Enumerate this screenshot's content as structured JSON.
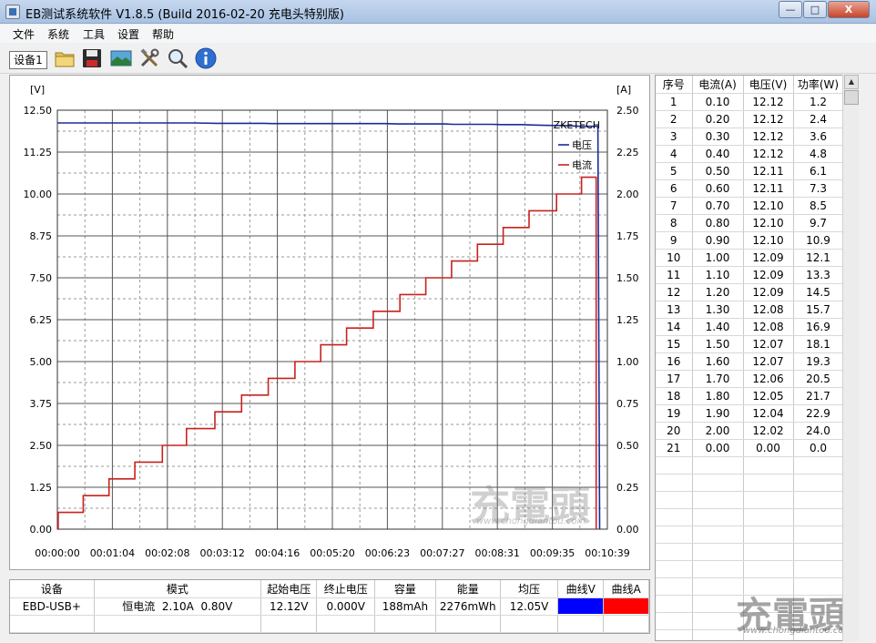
{
  "window": {
    "title": "EB测试系统软件 V1.8.5 (Build 2016-02-20 充电头特别版)",
    "minimize": "—",
    "maximize": "□",
    "close": "X"
  },
  "menu": [
    "文件",
    "系统",
    "工具",
    "设置",
    "帮助"
  ],
  "toolbar": {
    "device_tab": "设备1",
    "icons": [
      "folder-icon",
      "save-icon",
      "image-icon",
      "tools-icon",
      "zoom-icon",
      "info-icon"
    ]
  },
  "chart_data": {
    "type": "line",
    "title": "",
    "y_left_unit": "[V]",
    "y_right_unit": "[A]",
    "y_left_ticks": [
      "12.50",
      "11.25",
      "10.00",
      "8.75",
      "7.50",
      "6.25",
      "5.00",
      "3.75",
      "2.50",
      "1.25",
      "0.00"
    ],
    "y_right_ticks": [
      "2.50",
      "2.25",
      "2.00",
      "1.75",
      "1.50",
      "1.25",
      "1.00",
      "0.75",
      "0.50",
      "0.25",
      "0.00"
    ],
    "x_ticks": [
      "00:00:00",
      "00:01:04",
      "00:02:08",
      "00:03:12",
      "00:04:16",
      "00:05:20",
      "00:06:23",
      "00:07:27",
      "00:08:31",
      "00:09:35",
      "00:10:39"
    ],
    "ylim_left": [
      0,
      12.5
    ],
    "ylim_right": [
      0,
      2.5
    ],
    "xlim_seconds": [
      0,
      639
    ],
    "brand_label": "ZKETECH",
    "legend_position": "top-right",
    "series": [
      {
        "name": "电压",
        "axis": "left",
        "color": "#1c2a9a",
        "points": [
          [
            0,
            12.12
          ],
          [
            160,
            12.12
          ],
          [
            185,
            12.11
          ],
          [
            240,
            12.11
          ],
          [
            250,
            12.1
          ],
          [
            380,
            12.1
          ],
          [
            395,
            12.09
          ],
          [
            450,
            12.09
          ],
          [
            460,
            12.08
          ],
          [
            505,
            12.08
          ],
          [
            515,
            12.07
          ],
          [
            540,
            12.07
          ],
          [
            550,
            12.06
          ],
          [
            565,
            12.05
          ],
          [
            590,
            12.04
          ],
          [
            610,
            12.02
          ],
          [
            628,
            12.02
          ],
          [
            630,
            0.0
          ]
        ]
      },
      {
        "name": "电流",
        "axis": "right",
        "color": "#c8221e",
        "points": [
          [
            0,
            0.0
          ],
          [
            1,
            0.0
          ],
          [
            1,
            0.1
          ],
          [
            30,
            0.1
          ],
          [
            30,
            0.2
          ],
          [
            60,
            0.2
          ],
          [
            60,
            0.3
          ],
          [
            90,
            0.3
          ],
          [
            90,
            0.4
          ],
          [
            122,
            0.4
          ],
          [
            122,
            0.5
          ],
          [
            150,
            0.5
          ],
          [
            150,
            0.6
          ],
          [
            183,
            0.6
          ],
          [
            183,
            0.7
          ],
          [
            214,
            0.7
          ],
          [
            214,
            0.8
          ],
          [
            245,
            0.8
          ],
          [
            245,
            0.9
          ],
          [
            276,
            0.9
          ],
          [
            276,
            1.0
          ],
          [
            306,
            1.0
          ],
          [
            306,
            1.1
          ],
          [
            336,
            1.1
          ],
          [
            336,
            1.2
          ],
          [
            367,
            1.2
          ],
          [
            367,
            1.3
          ],
          [
            398,
            1.3
          ],
          [
            398,
            1.4
          ],
          [
            428,
            1.4
          ],
          [
            428,
            1.5
          ],
          [
            458,
            1.5
          ],
          [
            458,
            1.6
          ],
          [
            488,
            1.6
          ],
          [
            488,
            1.7
          ],
          [
            518,
            1.7
          ],
          [
            518,
            1.8
          ],
          [
            548,
            1.8
          ],
          [
            548,
            1.9
          ],
          [
            580,
            1.9
          ],
          [
            580,
            2.0
          ],
          [
            609,
            2.0
          ],
          [
            609,
            2.1
          ],
          [
            626,
            2.1
          ],
          [
            626,
            0.0
          ]
        ]
      }
    ]
  },
  "table": {
    "headers": [
      "序号",
      "电流(A)",
      "电压(V)",
      "功率(W)"
    ],
    "rows": [
      [
        "1",
        "0.10",
        "12.12",
        "1.2"
      ],
      [
        "2",
        "0.20",
        "12.12",
        "2.4"
      ],
      [
        "3",
        "0.30",
        "12.12",
        "3.6"
      ],
      [
        "4",
        "0.40",
        "12.12",
        "4.8"
      ],
      [
        "5",
        "0.50",
        "12.11",
        "6.1"
      ],
      [
        "6",
        "0.60",
        "12.11",
        "7.3"
      ],
      [
        "7",
        "0.70",
        "12.10",
        "8.5"
      ],
      [
        "8",
        "0.80",
        "12.10",
        "9.7"
      ],
      [
        "9",
        "0.90",
        "12.10",
        "10.9"
      ],
      [
        "10",
        "1.00",
        "12.09",
        "12.1"
      ],
      [
        "11",
        "1.10",
        "12.09",
        "13.3"
      ],
      [
        "12",
        "1.20",
        "12.09",
        "14.5"
      ],
      [
        "13",
        "1.30",
        "12.08",
        "15.7"
      ],
      [
        "14",
        "1.40",
        "12.08",
        "16.9"
      ],
      [
        "15",
        "1.50",
        "12.07",
        "18.1"
      ],
      [
        "16",
        "1.60",
        "12.07",
        "19.3"
      ],
      [
        "17",
        "1.70",
        "12.06",
        "20.5"
      ],
      [
        "18",
        "1.80",
        "12.05",
        "21.7"
      ],
      [
        "19",
        "1.90",
        "12.04",
        "22.9"
      ],
      [
        "20",
        "2.00",
        "12.02",
        "24.0"
      ],
      [
        "21",
        "0.00",
        "0.00",
        "0.0"
      ]
    ],
    "empty_rows": 11
  },
  "summary": {
    "headers": [
      "设备",
      "模式",
      "起始电压",
      "终止电压",
      "容量",
      "能量",
      "均压",
      "曲线V",
      "曲线A"
    ],
    "values": [
      "EBD-USB+",
      "恒电流  2.10A  0.80V",
      "12.12V",
      "0.000V",
      "188mAh",
      "2276mWh",
      "12.05V"
    ],
    "curve_v_color": "#0000ff",
    "curve_a_color": "#ff0000"
  },
  "watermark": {
    "text": "充電頭",
    "site": "www.chongdiantou.com"
  }
}
